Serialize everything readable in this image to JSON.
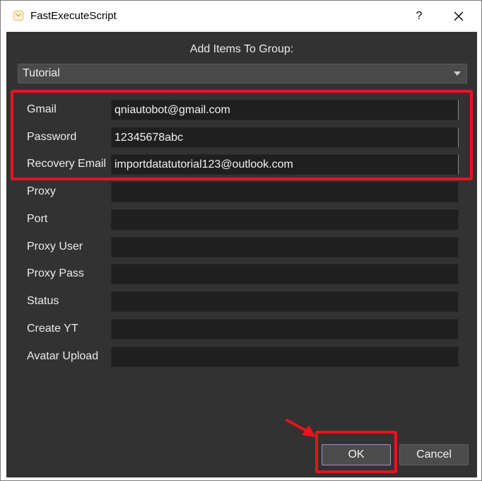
{
  "window": {
    "title": "FastExecuteScript",
    "help_label": "?",
    "icons": {
      "app": "mail-app-icon",
      "help": "help-icon",
      "close": "close-icon"
    }
  },
  "dialog": {
    "heading": "Add Items To Group:",
    "group_select": {
      "selected": "Tutorial"
    },
    "fields": [
      {
        "label": "Gmail",
        "value": "qniautobot@gmail.com"
      },
      {
        "label": "Password",
        "value": "12345678abc"
      },
      {
        "label": "Recovery Email",
        "value": "importdatatutorial123@outlook.com"
      },
      {
        "label": "Proxy",
        "value": ""
      },
      {
        "label": "Port",
        "value": ""
      },
      {
        "label": "Proxy User",
        "value": ""
      },
      {
        "label": "Proxy Pass",
        "value": ""
      },
      {
        "label": "Status",
        "value": ""
      },
      {
        "label": "Create YT",
        "value": ""
      },
      {
        "label": "Avatar Upload",
        "value": ""
      }
    ],
    "buttons": {
      "ok": "OK",
      "cancel": "Cancel"
    }
  },
  "colors": {
    "dialog_bg": "#323232",
    "input_bg": "#1f1f1f",
    "annotation_red": "#e8141c",
    "ok_focus_border": "#a78bd4"
  }
}
